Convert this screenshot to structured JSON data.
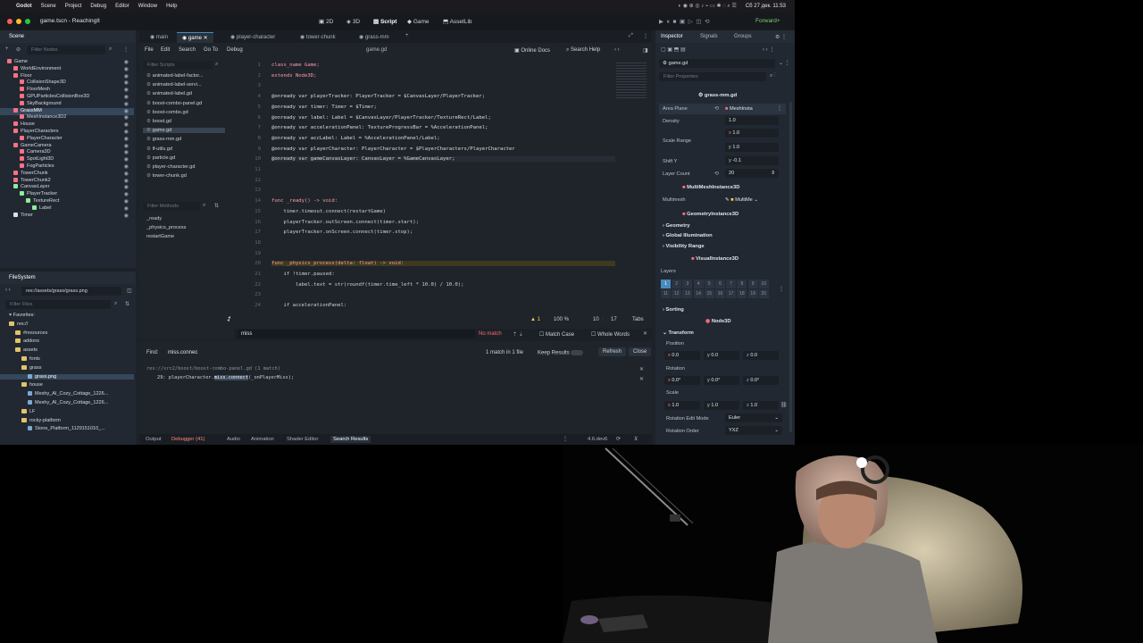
{
  "macbar": {
    "apple": "",
    "app": "Godot",
    "menus": [
      "Scene",
      "Project",
      "Debug",
      "Editor",
      "Window",
      "Help"
    ],
    "clock": "Сб 27 дек. 11:53"
  },
  "window": {
    "title": "game.tscn - ReachingIt",
    "workspaces": [
      "2D",
      "3D",
      "Script",
      "Game",
      "AssetLib"
    ],
    "active_workspace": "Script",
    "renderer": "Forward+"
  },
  "scene_dock": {
    "tabs": [
      "Scene",
      "Import"
    ],
    "filter_placeholder": "Filter Nodes",
    "nodes": [
      {
        "label": "Game",
        "indent": 0,
        "color": "#ff7085"
      },
      {
        "label": "WorldEnvironment",
        "indent": 1,
        "color": "#ff7085"
      },
      {
        "label": "Floor",
        "indent": 1,
        "color": "#ff7085"
      },
      {
        "label": "CollisionShape3D",
        "indent": 2,
        "color": "#ff7085"
      },
      {
        "label": "FloorMesh",
        "indent": 2,
        "color": "#ff7085"
      },
      {
        "label": "GPUParticlesCollisionBox3D",
        "indent": 2,
        "color": "#ff7085"
      },
      {
        "label": "SkyBackground",
        "indent": 2,
        "color": "#ff7085"
      },
      {
        "label": "GrassMM",
        "indent": 1,
        "color": "#ff7085",
        "selected": true
      },
      {
        "label": "MeshInstance3D2",
        "indent": 2,
        "color": "#ff7085"
      },
      {
        "label": "House",
        "indent": 1,
        "color": "#ff7085"
      },
      {
        "label": "PlayerCharacters",
        "indent": 1,
        "color": "#ff7085"
      },
      {
        "label": "PlayerCharacter",
        "indent": 2,
        "color": "#ff7085"
      },
      {
        "label": "GameCamera",
        "indent": 1,
        "color": "#ff7085"
      },
      {
        "label": "Camera3D",
        "indent": 2,
        "color": "#ff7085"
      },
      {
        "label": "SpotLight3D",
        "indent": 2,
        "color": "#ff7085"
      },
      {
        "label": "FogParticles",
        "indent": 2,
        "color": "#ff7085"
      },
      {
        "label": "TowerChunk",
        "indent": 1,
        "color": "#ff7085"
      },
      {
        "label": "TowerChunk2",
        "indent": 1,
        "color": "#ff7085"
      },
      {
        "label": "CanvasLayer",
        "indent": 1,
        "color": "#8eef97"
      },
      {
        "label": "PlayerTracker",
        "indent": 2,
        "color": "#8eef97"
      },
      {
        "label": "TextureRect",
        "indent": 3,
        "color": "#8eef97"
      },
      {
        "label": "Label",
        "indent": 4,
        "color": "#8eef97"
      },
      {
        "label": "Timer",
        "indent": 1,
        "color": "#e0e0e0"
      }
    ]
  },
  "filesystem": {
    "title": "FileSystem",
    "path": "res://assets/grass/grass.png",
    "filter_placeholder": "Filter Files",
    "items": [
      {
        "label": "Favorites:",
        "indent": 0,
        "kind": "fav"
      },
      {
        "label": "res://",
        "indent": 0,
        "kind": "folder"
      },
      {
        "label": "#resources",
        "indent": 1,
        "kind": "folder"
      },
      {
        "label": "addons",
        "indent": 1,
        "kind": "folder"
      },
      {
        "label": "assets",
        "indent": 1,
        "kind": "folder"
      },
      {
        "label": "fonts",
        "indent": 2,
        "kind": "folder"
      },
      {
        "label": "grass",
        "indent": 2,
        "kind": "folder"
      },
      {
        "label": "grass.png",
        "indent": 3,
        "kind": "file",
        "selected": true
      },
      {
        "label": "house",
        "indent": 2,
        "kind": "folder"
      },
      {
        "label": "Meshy_AI_Cozy_Cottage_1226...",
        "indent": 3,
        "kind": "file"
      },
      {
        "label": "Meshy_AI_Cozy_Cottage_1226...",
        "indent": 3,
        "kind": "file"
      },
      {
        "label": "LF",
        "indent": 2,
        "kind": "folder"
      },
      {
        "label": "rocky-platform",
        "indent": 2,
        "kind": "folder"
      },
      {
        "label": "Stone_Platform_1129151010_...",
        "indent": 3,
        "kind": "file"
      }
    ]
  },
  "script_editor": {
    "tabs": [
      "main",
      "game",
      "player-character",
      "tower-chunk",
      "grass-mm"
    ],
    "active_tab": "game",
    "menus": [
      "File",
      "Edit",
      "Search",
      "Go To",
      "Debug"
    ],
    "file_label": "game.gd",
    "online_docs": "Online Docs",
    "search_help": "Search Help",
    "filter_scripts": "Filter Scripts",
    "scripts": [
      "animated-label-factor...",
      "animated-label-servi...",
      "animated-label.gd",
      "boost-combo-panel.gd",
      "boost-combo.gd",
      "boost.gd",
      "game.gd",
      "grass-mm.gd",
      "lf-utils.gd",
      "particle.gd",
      "player-character.gd",
      "tower-chunk.gd"
    ],
    "selected_script": "game.gd",
    "filter_methods": "Filter Methods",
    "methods": [
      "_ready",
      "_physics_process",
      "restartGame"
    ],
    "lines": [
      {
        "n": "1",
        "t": "class_name Game;"
      },
      {
        "n": "2",
        "t": "extends Node3D;"
      },
      {
        "n": "3",
        "t": ""
      },
      {
        "n": "4",
        "t": "@onready var playerTracker: PlayerTracker = $CanvasLayer/PlayerTracker;"
      },
      {
        "n": "5",
        "t": "@onready var timer: Timer = $Timer;"
      },
      {
        "n": "6",
        "t": "@onready var label: Label = $CanvasLayer/PlayerTracker/TextureRect/Label;"
      },
      {
        "n": "7",
        "t": "@onready var accelerationPanel: TextureProgressBar = %AccelerationPanel;"
      },
      {
        "n": "8",
        "t": "@onready var accLabel: Label = %AccelerationPanel/Label;"
      },
      {
        "n": "9",
        "t": "@onready var playerCharacter: PlayerCharacter = $PlayerCharacters/PlayerCharacter"
      },
      {
        "n": "10",
        "t": "@onready var gameCanvasLayer: CanvasLayer = %GameCanvasLayer;"
      },
      {
        "n": "11",
        "t": ""
      },
      {
        "n": "12",
        "t": ""
      },
      {
        "n": "13",
        "t": ""
      },
      {
        "n": "14",
        "t": "func _ready() -> void:"
      },
      {
        "n": "15",
        "t": "    timer.timeout.connect(restartGame)"
      },
      {
        "n": "16",
        "t": "    playerTracker.outScreen.connect(timer.start);"
      },
      {
        "n": "17",
        "t": "    playerTracker.onScreen.connect(timer.stop);"
      },
      {
        "n": "18",
        "t": ""
      },
      {
        "n": "19",
        "t": ""
      },
      {
        "n": "20",
        "t": "func _physics_process(delta: float) -> void:"
      },
      {
        "n": "21",
        "t": "    if !timer.paused:"
      },
      {
        "n": "22",
        "t": "        label.text = str(roundf(timer.time_left * 10.0) / 10.0);"
      },
      {
        "n": "23",
        "t": ""
      },
      {
        "n": "24",
        "t": "    if accelerationPanel:"
      }
    ],
    "status": {
      "warnings": "1",
      "zoom": "100 %",
      "line": "10",
      "col": "17",
      "indent": "Tabs"
    },
    "inline_find": {
      "value": "miss",
      "result": "No match",
      "match_case": "Match Case",
      "whole_words": "Whole Words"
    }
  },
  "find_panel": {
    "label": "Find:",
    "query": "miss.connec",
    "summary": "1 match in 1 file",
    "keep_results": "Keep Results",
    "refresh": "Refresh",
    "close": "Close",
    "file": "res://src2/boost/boost-combo-panel.gd (1 match)",
    "line_no": "29:",
    "code_before": "playerCharacter.",
    "code_match": "miss.connect",
    "code_after": "(_onPlayerMiss);"
  },
  "bottom_tabs": [
    "Output",
    "Debugger (41)",
    "Audio",
    "Animation",
    "Shader Editor",
    "Search Results"
  ],
  "version": "4.6.dev6",
  "inspector": {
    "tabs": [
      "Inspector",
      "Signals",
      "Groups"
    ],
    "resource": "game.gd",
    "filter_placeholder": "Filter Properties",
    "script_name": "grass-mm.gd",
    "area_plane_label": "Area Plane",
    "area_plane_value": "MeshInsta",
    "density_label": "Density",
    "density_value": "1.0",
    "scale_range_label": "Scale Range",
    "scale_x": "1.0",
    "scale_y": "1.0",
    "shift_y_label": "Shift Y",
    "shift_y_value": "-0.1",
    "layer_count_label": "Layer Count",
    "layer_count_value": "20",
    "mmi_section": "MultiMeshInstance3D",
    "multimesh_label": "Multimesh",
    "multimesh_value": "MultiMe",
    "gi_section": "GeometryInstance3D",
    "geometry": "Geometry",
    "global_illumination": "Global Illumination",
    "visibility_range": "Visibility Range",
    "vi_section": "VisualInstance3D",
    "layers_label": "Layers",
    "layers_row1": [
      "1",
      "2",
      "3",
      "4",
      "5",
      "6",
      "7",
      "8",
      "9",
      "10",
      "11",
      "12",
      "13",
      "14",
      "15",
      "16",
      "17",
      "18",
      "19",
      "20"
    ],
    "sorting": "Sorting",
    "node3d_section": "Node3D",
    "transform": "Transform",
    "position_label": "Position",
    "pos_x": "0.0",
    "pos_y": "0.0",
    "pos_z": "0.0",
    "rotation_label": "Rotation",
    "rot_x": "0.0°",
    "rot_y": "0.0°",
    "rot_z": "0.0°",
    "scale_label": "Scale",
    "sc_x": "1.0",
    "sc_y": "1.0",
    "sc_z": "1.0",
    "rot_mode_label": "Rotation Edit Mode",
    "rot_mode_value": "Euler",
    "rot_order_label": "Rotation Order",
    "rot_order_value": "YXZ"
  },
  "colors": {
    "accent": "#478cbf",
    "bg": "#1d2229",
    "panel": "#222831"
  }
}
